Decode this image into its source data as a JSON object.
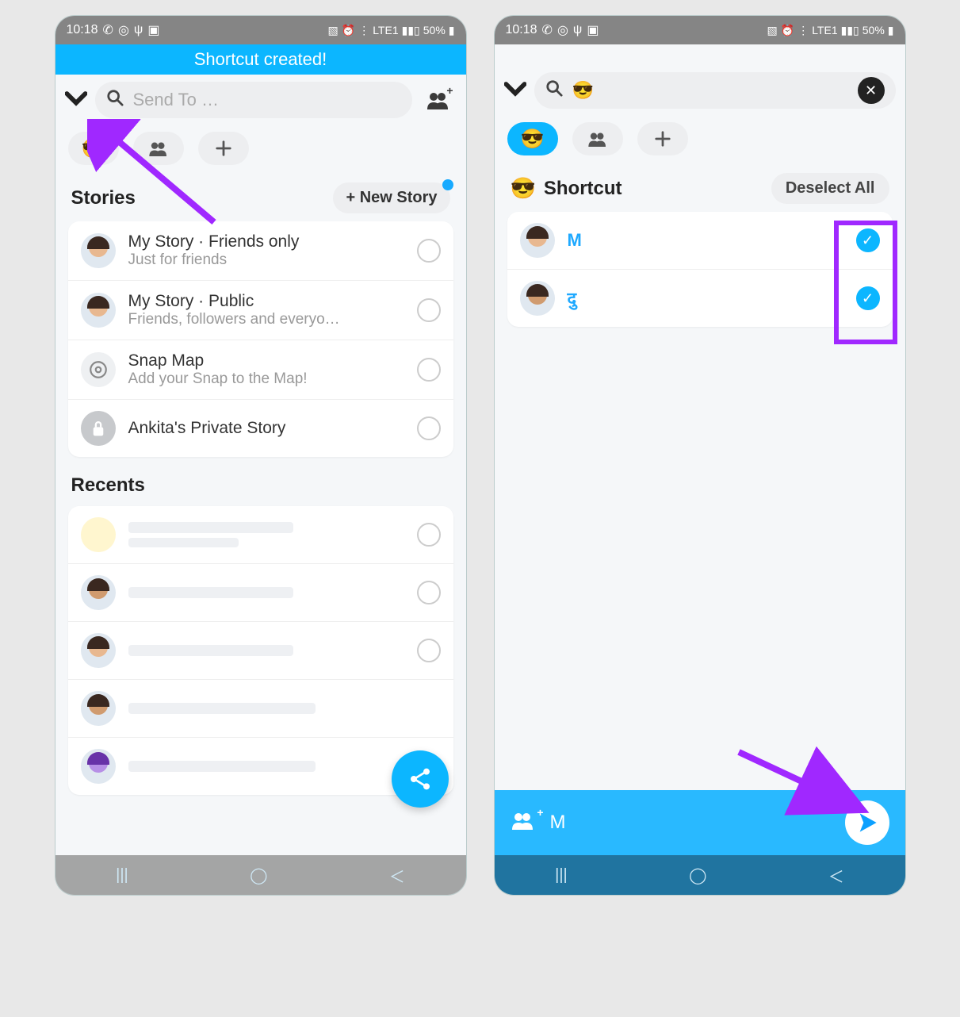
{
  "status": {
    "time": "10:18",
    "battery": "50%",
    "network": "LTE1"
  },
  "left": {
    "banner": "Shortcut created!",
    "search_placeholder": "Send To …",
    "shortcut_emoji": "😎",
    "stories_label": "Stories",
    "new_story_label": "+ New Story",
    "stories": [
      {
        "title": "My Story · Friends only",
        "sub": "Just for friends",
        "avatar": "face"
      },
      {
        "title": "My Story · Public",
        "sub": "Friends, followers and everyo…",
        "avatar": "face"
      },
      {
        "title": "Snap Map",
        "sub": "Add your Snap to the Map!",
        "avatar": "map"
      },
      {
        "title": "Ankita's Private Story",
        "sub": "",
        "avatar": "lock"
      }
    ],
    "recents_label": "Recents"
  },
  "right": {
    "search_emoji": "😎",
    "shortcut_label": "Shortcut",
    "deselect_label": "Deselect All",
    "members": [
      {
        "name_visible": "M",
        "checked": true
      },
      {
        "name_visible": "दु",
        "checked": true
      }
    ],
    "send_name": "M"
  }
}
